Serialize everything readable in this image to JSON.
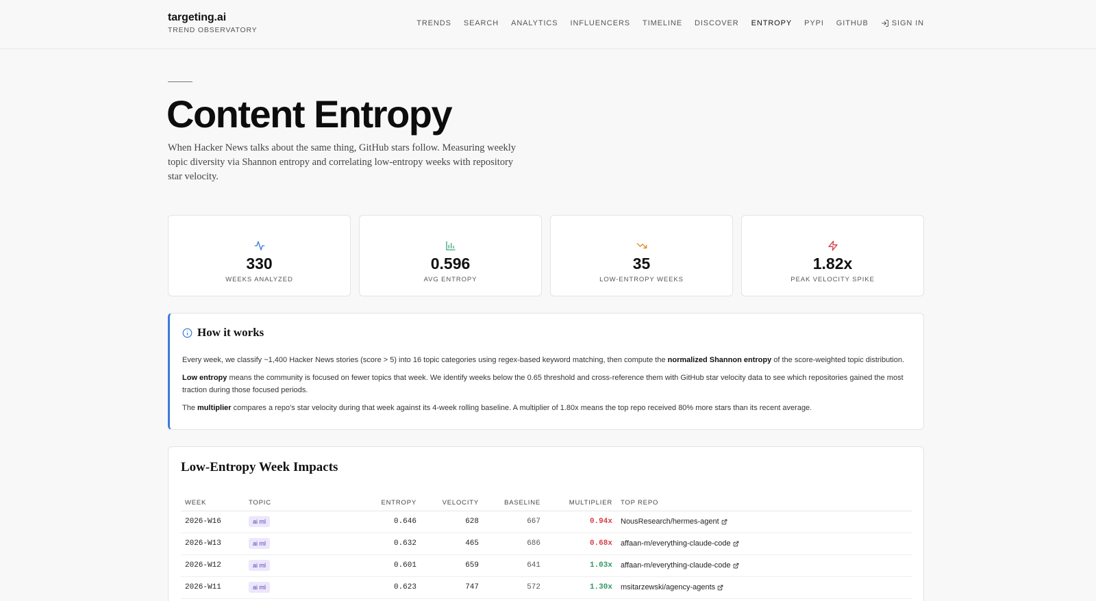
{
  "brand": {
    "name": "targeting.ai",
    "subtitle": "TREND OBSERVATORY"
  },
  "nav": {
    "items": [
      "TRENDS",
      "SEARCH",
      "ANALYTICS",
      "INFLUENCERS",
      "TIMELINE",
      "DISCOVER",
      "ENTROPY",
      "PYPI",
      "GITHUB"
    ],
    "active": "ENTROPY",
    "signin": "SIGN IN"
  },
  "page": {
    "title": "Content Entropy",
    "description": "When Hacker News talks about the same thing, GitHub stars follow. Measuring weekly topic diversity via Shannon entropy and correlating low-entropy weeks with repository star velocity."
  },
  "stats": [
    {
      "icon": "activity-pulse-icon",
      "color": "#3b7bd9",
      "value": "330",
      "label": "WEEKS ANALYZED"
    },
    {
      "icon": "bar-chart-icon",
      "color": "#3aa676",
      "value": "0.596",
      "label": "AVG ENTROPY"
    },
    {
      "icon": "trending-down-icon",
      "color": "#e0891f",
      "value": "35",
      "label": "LOW-ENTROPY WEEKS"
    },
    {
      "icon": "lightning-icon",
      "color": "#d6404b",
      "value": "1.82x",
      "label": "PEAK VELOCITY SPIKE"
    }
  ],
  "how_it_works": {
    "title": "How it works",
    "p1_a": "Every week, we classify ~1,400 Hacker News stories (score > 5) into 16 topic categories using regex-based keyword matching, then compute the ",
    "p1_b": "normalized Shannon entropy",
    "p1_c": " of the score-weighted topic distribution.",
    "p2_a": "Low entropy",
    "p2_b": " means the community is focused on fewer topics that week. We identify weeks below the 0.65 threshold and cross-reference them with GitHub star velocity data to see which repositories gained the most traction during those focused periods.",
    "p3_a": "The ",
    "p3_b": "multiplier",
    "p3_c": " compares a repo's star velocity during that week against its 4-week rolling baseline. A multiplier of 1.80x means the top repo received 80% more stars than its recent average."
  },
  "impacts": {
    "title": "Low-Entropy Week Impacts",
    "columns": {
      "week": "WEEK",
      "topic": "TOPIC",
      "entropy": "ENTROPY",
      "velocity": "VELOCITY",
      "baseline": "BASELINE",
      "multiplier": "MULTIPLIER",
      "top_repo": "TOP REPO"
    },
    "colors": {
      "down": "#d6404b",
      "up": "#2e9a61"
    },
    "rows": [
      {
        "week": "2026-W16",
        "topic": "ai ml",
        "entropy": "0.646",
        "velocity": "628",
        "baseline": "667",
        "multiplier": "0.94x",
        "trend": "down",
        "repo": "NousResearch/hermes-agent"
      },
      {
        "week": "2026-W13",
        "topic": "ai ml",
        "entropy": "0.632",
        "velocity": "465",
        "baseline": "686",
        "multiplier": "0.68x",
        "trend": "down",
        "repo": "affaan-m/everything-claude-code"
      },
      {
        "week": "2026-W12",
        "topic": "ai ml",
        "entropy": "0.601",
        "velocity": "659",
        "baseline": "641",
        "multiplier": "1.03x",
        "trend": "up",
        "repo": "affaan-m/everything-claude-code"
      },
      {
        "week": "2026-W11",
        "topic": "ai ml",
        "entropy": "0.623",
        "velocity": "747",
        "baseline": "572",
        "multiplier": "1.30x",
        "trend": "up",
        "repo": "msitarzewski/agency-agents"
      }
    ]
  }
}
